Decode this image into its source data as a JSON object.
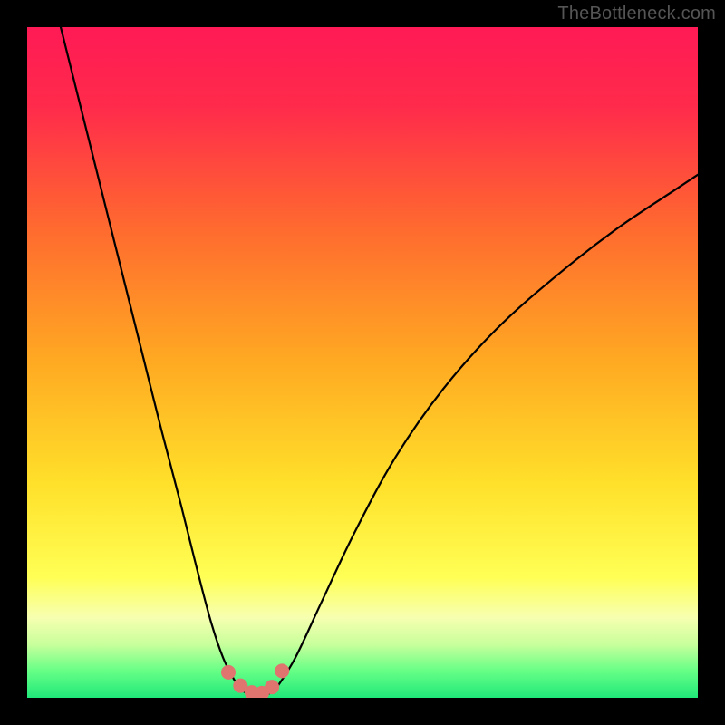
{
  "watermark": "TheBottleneck.com",
  "colors": {
    "gradient_stops": [
      {
        "offset": 0.0,
        "color": "#ff1a55"
      },
      {
        "offset": 0.12,
        "color": "#ff2b4b"
      },
      {
        "offset": 0.3,
        "color": "#ff6a2f"
      },
      {
        "offset": 0.5,
        "color": "#ffaa22"
      },
      {
        "offset": 0.68,
        "color": "#ffe02a"
      },
      {
        "offset": 0.82,
        "color": "#ffff55"
      },
      {
        "offset": 0.88,
        "color": "#f7ffb0"
      },
      {
        "offset": 0.92,
        "color": "#c9ff9c"
      },
      {
        "offset": 0.96,
        "color": "#66ff86"
      },
      {
        "offset": 1.0,
        "color": "#20e87a"
      }
    ],
    "curve_stroke": "#000000",
    "marker_fill": "#e0746f",
    "frame_bg": "#000000"
  },
  "chart_data": {
    "type": "line",
    "title": "",
    "xlabel": "",
    "ylabel": "",
    "xlim": [
      0,
      1
    ],
    "ylim": [
      0,
      1
    ],
    "note": "Axes are unitless screen-relative; y=1 is top, y=0 is bottom. Curve is a V-shaped bottleneck plot.",
    "series": [
      {
        "name": "left-branch",
        "x": [
          0.05,
          0.08,
          0.11,
          0.14,
          0.17,
          0.2,
          0.23,
          0.255,
          0.275,
          0.292,
          0.308,
          0.318
        ],
        "y": [
          1.0,
          0.88,
          0.76,
          0.64,
          0.52,
          0.4,
          0.285,
          0.185,
          0.11,
          0.06,
          0.028,
          0.012
        ]
      },
      {
        "name": "trough",
        "x": [
          0.318,
          0.33,
          0.345,
          0.36,
          0.372
        ],
        "y": [
          0.012,
          0.006,
          0.003,
          0.006,
          0.015
        ]
      },
      {
        "name": "right-branch",
        "x": [
          0.372,
          0.4,
          0.44,
          0.49,
          0.55,
          0.62,
          0.7,
          0.79,
          0.88,
          0.97,
          1.0
        ],
        "y": [
          0.015,
          0.06,
          0.145,
          0.25,
          0.36,
          0.46,
          0.55,
          0.63,
          0.7,
          0.76,
          0.78
        ]
      }
    ],
    "markers": {
      "name": "trough-markers",
      "x": [
        0.3,
        0.318,
        0.335,
        0.35,
        0.365,
        0.38
      ],
      "y": [
        0.038,
        0.018,
        0.008,
        0.007,
        0.016,
        0.04
      ],
      "r": 8
    }
  }
}
